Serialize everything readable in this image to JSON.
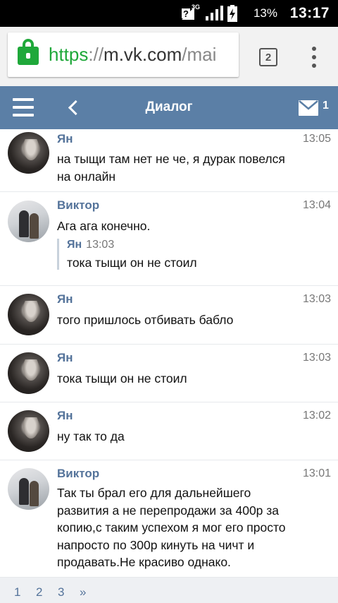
{
  "status_bar": {
    "network": "3G",
    "battery_percent": "13%",
    "time": "13:17",
    "icons": [
      "alert-icon",
      "signal-icon",
      "battery-charging-icon"
    ]
  },
  "browser": {
    "url_scheme": "https",
    "url_separator": "://",
    "url_host": "m.vk.com",
    "url_path": "/mai",
    "tab_count": "2",
    "icons": [
      "lock-icon",
      "tabs-icon",
      "overflow-menu-icon"
    ]
  },
  "header": {
    "title": "Диалог",
    "unread_count": "1",
    "icons": [
      "hamburger-menu-icon",
      "back-icon",
      "mail-icon"
    ],
    "accent_color": "#5b7fa6"
  },
  "messages": [
    {
      "author": "Ян",
      "time": "13:05",
      "text": "на тыщи там нет не че, я дурак повелся на онлайн"
    },
    {
      "author": "Виктор",
      "time": "13:04",
      "text": "Ага ага конечно.",
      "reply": {
        "author": "Ян",
        "time": "13:03",
        "text": "тока тыщи он не стоил"
      }
    },
    {
      "author": "Ян",
      "time": "13:03",
      "text": "того пришлось отбивать бабло"
    },
    {
      "author": "Ян",
      "time": "13:03",
      "text": "тока тыщи он не стоил"
    },
    {
      "author": "Ян",
      "time": "13:02",
      "text": "ну так то да"
    },
    {
      "author": "Виктор",
      "time": "13:01",
      "text": "Так ты брал его для дальнейшего развития а не перепродажи за 400р за копию,с таким успехом я мог его просто напросто по 300р кинуть на чичт и продавать.Не красиво однако."
    }
  ],
  "pagination": {
    "pages": [
      "1",
      "2",
      "3"
    ],
    "next": "»"
  },
  "colors": {
    "author_link": "#54739a",
    "secure_green": "#1fa83a"
  }
}
